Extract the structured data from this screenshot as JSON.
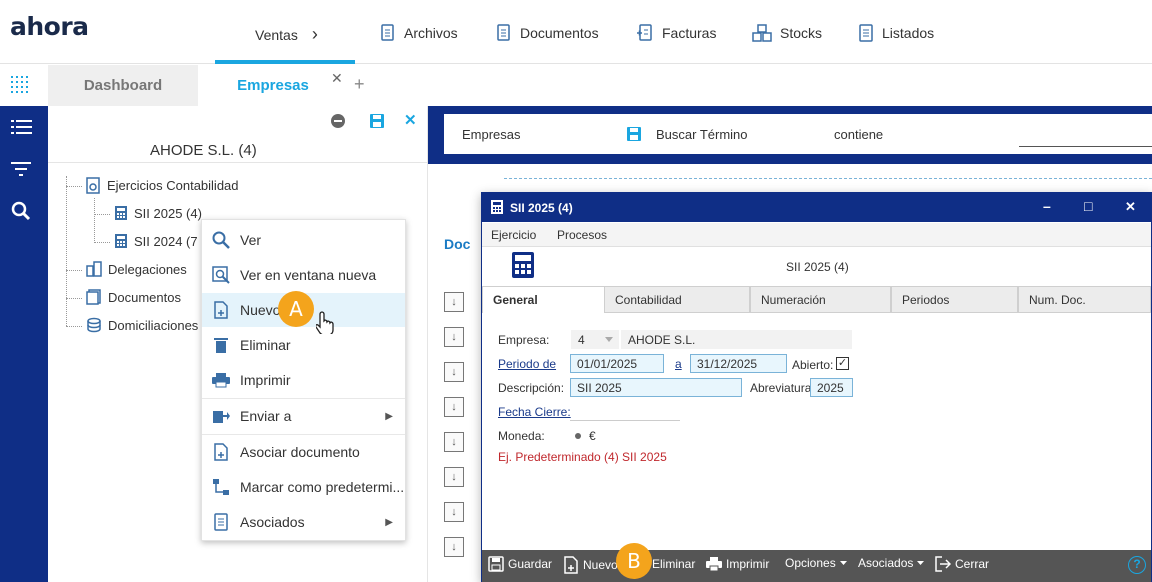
{
  "brand": {
    "logo_text": "ahora"
  },
  "topnav": {
    "items": [
      {
        "label": "Ventas"
      },
      {
        "label": "Archivos"
      },
      {
        "label": "Documentos"
      },
      {
        "label": "Facturas"
      },
      {
        "label": "Stocks"
      },
      {
        "label": "Listados"
      }
    ],
    "chevron": "›"
  },
  "tabs": {
    "items": [
      {
        "label": "Dashboard"
      },
      {
        "label": "Empresas"
      }
    ],
    "close_glyph": "✕",
    "add_glyph": "+"
  },
  "left_panel": {
    "company_title": "AHODE S.L. (4)",
    "tree": [
      {
        "label": "Ejercicios Contabilidad"
      },
      {
        "label": "SII 2025 (4)"
      },
      {
        "label": "SII 2024 (7"
      },
      {
        "label": "Delegaciones"
      },
      {
        "label": "Documentos"
      },
      {
        "label": "Domiciliaciones"
      }
    ]
  },
  "context_menu": {
    "items": [
      {
        "label": "Ver"
      },
      {
        "label": "Ver en ventana nueva"
      },
      {
        "label": "Nuevo"
      },
      {
        "label": "Eliminar"
      },
      {
        "label": "Imprimir"
      },
      {
        "label": "Enviar a"
      },
      {
        "label": "Asociar documento"
      },
      {
        "label": "Marcar como predetermi..."
      },
      {
        "label": "Asociados"
      }
    ]
  },
  "badges": {
    "a": "A",
    "b": "B"
  },
  "filterbar": {
    "entity": "Empresas",
    "search_label": "Buscar Término",
    "operator": "contiene"
  },
  "list": {
    "column_label": "Doc"
  },
  "dialog": {
    "title": "SII 2025 (4)",
    "menu": [
      {
        "label": "Ejercicio"
      },
      {
        "label": "Procesos"
      }
    ],
    "header_label": "SII 2025 (4)",
    "tabs": [
      {
        "label": "General"
      },
      {
        "label": "Contabilidad"
      },
      {
        "label": "Numeración"
      },
      {
        "label": "Periodos"
      },
      {
        "label": "Num. Doc."
      }
    ],
    "form": {
      "empresa_label": "Empresa:",
      "empresa_code": "4",
      "empresa_name": "AHODE S.L.",
      "periodo_label": "Periodo de",
      "periodo_from": "01/01/2025",
      "periodo_a": "a",
      "periodo_to": "31/12/2025",
      "abierto_label": "Abierto:",
      "abierto_checked": true,
      "descripcion_label": "Descripción:",
      "descripcion_value": "SII 2025",
      "abreviatura_label": "Abreviatura",
      "abreviatura_value": "2025",
      "fecha_cierre_label": "Fecha Cierre:",
      "moneda_label": "Moneda:",
      "moneda_value": "€",
      "predeterminado_text": "Ej. Predeterminado (4) SII 2025"
    },
    "toolbar": {
      "guardar": "Guardar",
      "nuevo": "Nuevo",
      "eliminar": "Eliminar",
      "imprimir": "Imprimir",
      "opciones": "Opciones",
      "asociados": "Asociados",
      "cerrar": "Cerrar"
    },
    "window_controls": {
      "minimize": "–",
      "maximize": "□",
      "close": "✕"
    }
  },
  "colors": {
    "navy": "#0f2e86",
    "accent": "#1aa6e0",
    "badge": "#f4a41c",
    "error_red": "#c0282d"
  }
}
